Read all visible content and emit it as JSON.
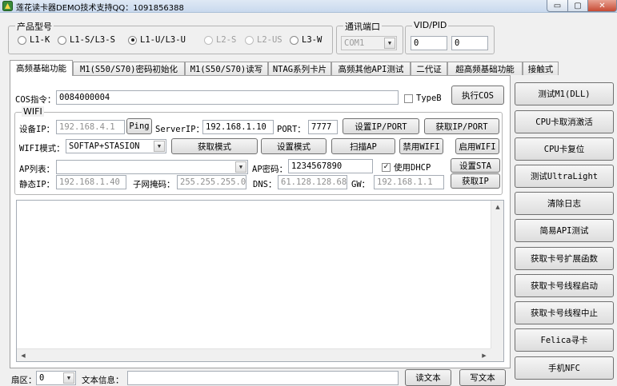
{
  "window": {
    "title": "莲花读卡器DEMO技术支持QQ：1091856388",
    "min_icon": "▭",
    "max_icon": "▢",
    "close_icon": "✕"
  },
  "product_group": {
    "title": "产品型号",
    "options": [
      {
        "label": "L1-K",
        "selected": false,
        "enabled": true
      },
      {
        "label": "L1-S/L3-S",
        "selected": false,
        "enabled": true
      },
      {
        "label": "L1-U/L3-U",
        "selected": true,
        "enabled": true
      },
      {
        "label": "L2-S",
        "selected": false,
        "enabled": false
      },
      {
        "label": "L2-US",
        "selected": false,
        "enabled": false
      },
      {
        "label": "L3-W",
        "selected": false,
        "enabled": true
      }
    ]
  },
  "port_group": {
    "title": "通讯端口",
    "value": "COM1"
  },
  "vidpid_group": {
    "title": "VID/PID",
    "vid": "0",
    "pid": "0"
  },
  "tabs": [
    {
      "label": "高频基础功能",
      "active": true
    },
    {
      "label": "M1(S50/S70)密码初始化",
      "active": false
    },
    {
      "label": "M1(S50/S70)读写",
      "active": false
    },
    {
      "label": "NTAG系列卡片",
      "active": false
    },
    {
      "label": "高频其他API测试",
      "active": false
    },
    {
      "label": "二代证",
      "active": false
    },
    {
      "label": "超高频基础功能",
      "active": false
    },
    {
      "label": "接触式",
      "active": false
    }
  ],
  "cos": {
    "label": "COS指令：",
    "value": "0084000004",
    "typeb_label": "TypeB",
    "exec_button": "执行COS"
  },
  "wifi": {
    "title": "WIFI",
    "device_ip_label": "设备IP：",
    "device_ip": "192.168.4.1",
    "ping_button": "Ping",
    "server_ip_label": "ServerIP：",
    "server_ip": "192.168.1.10",
    "port_label": "PORT：",
    "port": "7777",
    "set_ipport_button": "设置IP/PORT",
    "get_ipport_button": "获取IP/PORT",
    "mode_label": "WIFI模式：",
    "mode_value": "SOFTAP+STASION",
    "get_mode_button": "获取模式",
    "set_mode_button": "设置模式",
    "scan_ap_button": "扫描AP",
    "disable_wifi_button": "禁用WIFI",
    "enable_wifi_button": "启用WIFI",
    "ap_list_label": "AP列表：",
    "ap_list_value": "",
    "ap_password_label": "AP密码：",
    "ap_password": "1234567890",
    "dhcp_label": "使用DHCP",
    "dhcp_checked": true,
    "set_sta_button": "设置STA",
    "static_ip_label": "静态IP：",
    "static_ip": "192.168.1.40",
    "subnet_label": "子网掩码：",
    "subnet": "255.255.255.0",
    "dns_label": "DNS：",
    "dns": "61.128.128.68",
    "gw_label": "GW：",
    "gw": "192.168.1.1",
    "get_ip_button": "获取IP"
  },
  "bottom": {
    "sector_label": "扇区：",
    "sector_value": "0",
    "text_info_label": "文本信息：",
    "text_info_value": "",
    "read_text_button": "读文本",
    "write_text_button": "写文本"
  },
  "right_buttons": [
    "测试M1(DLL)",
    "CPU卡取消激活",
    "CPU卡复位",
    "测试UltraLight",
    "清除日志",
    "简易API测试",
    "获取卡号扩展函数",
    "获取卡号线程启动",
    "获取卡号线程中止",
    "Felica寻卡",
    "手机NFC"
  ]
}
